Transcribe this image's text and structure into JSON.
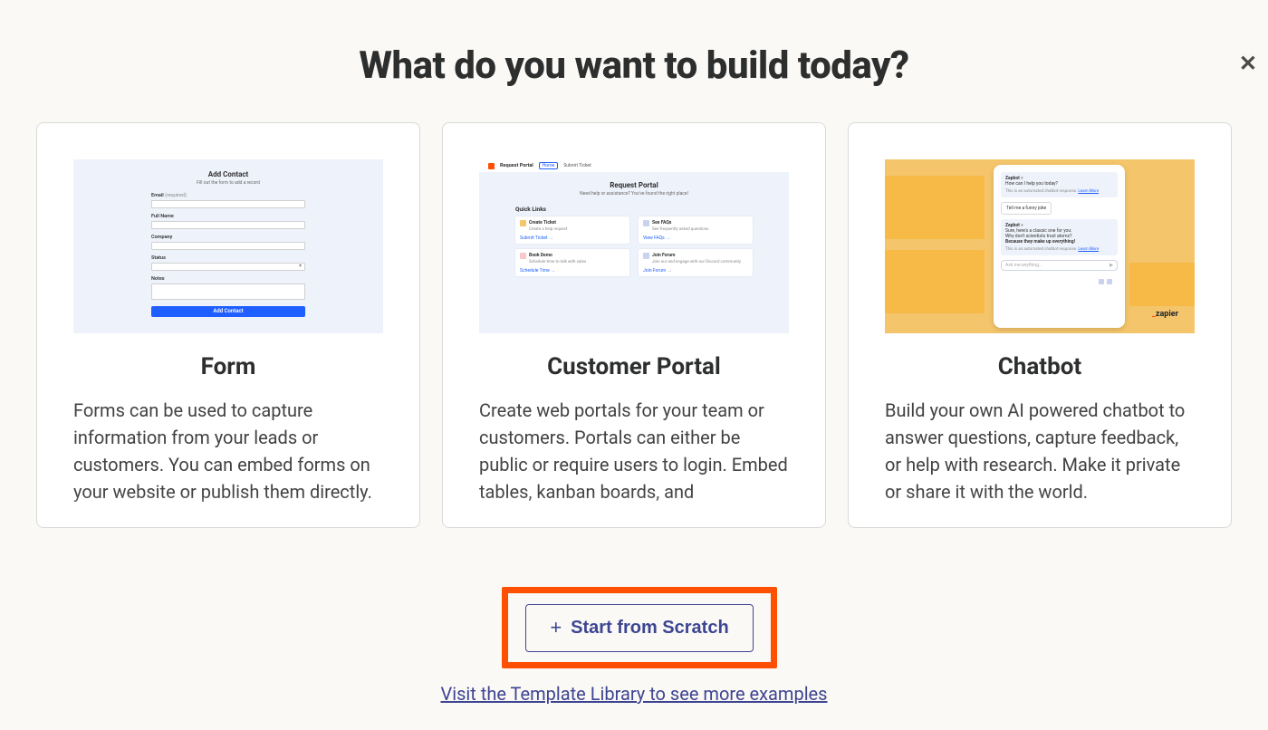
{
  "heading": "What do you want to build today?",
  "close_label": "✕",
  "cards": [
    {
      "title": "Form",
      "desc": "Forms can be used to capture information from your leads or customers. You can embed forms on your website or publish them directly.",
      "preview": {
        "title": "Add Contact",
        "sub": "Fill out the form to add a record",
        "labels": {
          "email": "Email",
          "req": " (required)",
          "fullname": "Full Name",
          "company": "Company",
          "status": "Status",
          "notes": "Notes"
        },
        "button": "Add Contact"
      }
    },
    {
      "title": "Customer Portal",
      "desc": "Create web portals for your team or customers. Portals can either be public or require users to login. Embed tables, kanban boards, and ",
      "preview": {
        "brand": "Request Portal",
        "tab1": "Home",
        "tab2": "Submit Ticket",
        "title": "Request Portal",
        "sub": "Need help or assistance? You've found the right place!",
        "ql": "Quick Links",
        "cards": [
          {
            "title": "Create Ticket",
            "sub": "Create a help request",
            "link": "Submit Ticket →",
            "color": "#f4c56b"
          },
          {
            "title": "See FAQs",
            "sub": "See frequently asked questions",
            "link": "View FAQs →",
            "color": "#eef2fb"
          },
          {
            "title": "Book Demo",
            "sub": "Schedule time to talk with sales",
            "link": "Schedule Time →",
            "color": "#f9c9c9"
          },
          {
            "title": "Join Forum",
            "sub": "Join our and engage with our Discord community",
            "link": "Join Forum →",
            "color": "#eef2fb"
          }
        ]
      }
    },
    {
      "title": "Chatbot",
      "desc": "Build your own AI powered chatbot to answer questions, capture feedback, or help with research. Make it private or share it with the world.",
      "preview": {
        "brand": "zapier",
        "bot_name": "Zapbot",
        "greeting": "How can I help you today?",
        "disclaimer": "This is an automated chatbot response.",
        "disclaimer_link": "Learn More",
        "user_msg": "Tell me a funny joke",
        "reply_lead": "Sure, here's a classic one for you:",
        "reply_q": "Why don't scientists trust atoms?",
        "reply_a": "Because they make up everything!",
        "placeholder": "Ask me anything..."
      }
    }
  ],
  "scratch_button": "Start from Scratch",
  "library_link": "Visit the Template Library to see more examples"
}
